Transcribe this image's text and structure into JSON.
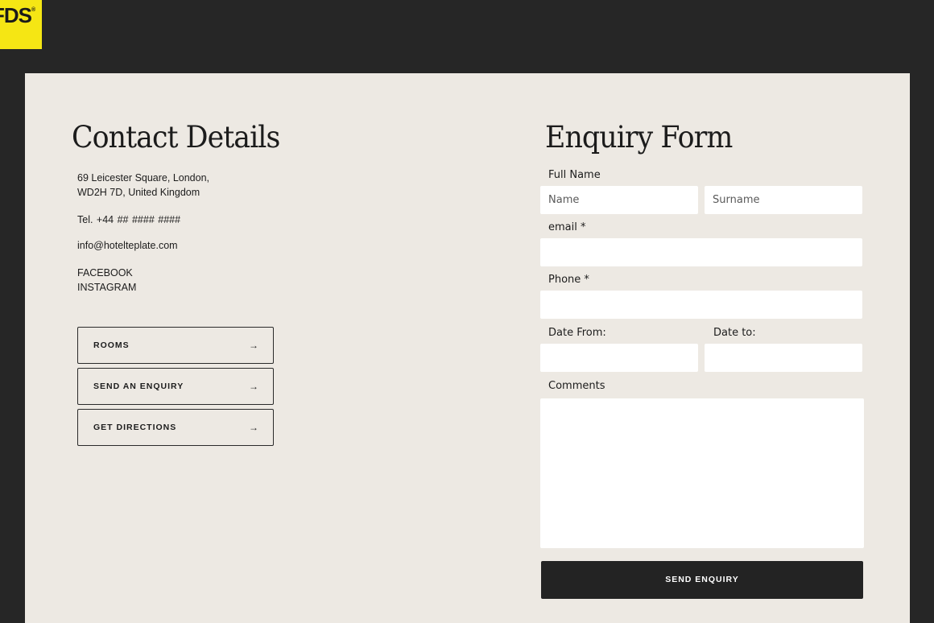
{
  "logo": {
    "text": "FDS",
    "reg": "®"
  },
  "contact": {
    "title": "Contact Details",
    "address_line1": "69 Leicester Square, London,",
    "address_line2": "WD2H 7D, United Kingdom",
    "tel": "Tel.  +44 ## #### ####",
    "email": "info@hotelteplate.com",
    "social": [
      "FACEBOOK",
      "INSTAGRAM"
    ],
    "links": [
      {
        "label": "ROOMS",
        "arrow": "→"
      },
      {
        "label": "SEND AN ENQUIRY",
        "arrow": "→"
      },
      {
        "label": "GET DIRECTIONS",
        "arrow": "→"
      }
    ]
  },
  "form": {
    "title": "Enquiry Form",
    "full_name_label": "Full Name",
    "name_placeholder": "Name",
    "surname_placeholder": "Surname",
    "email_label": "email *",
    "phone_label": "Phone *",
    "date_from_label": "Date From:",
    "date_to_label": "Date to:",
    "comments_label": "Comments",
    "submit_label": "SEND ENQUIRY"
  },
  "colors": {
    "logo_bg": "#f5e614",
    "page_bg": "#262626",
    "card_bg": "#ede9e3",
    "button_bg": "#232323"
  }
}
